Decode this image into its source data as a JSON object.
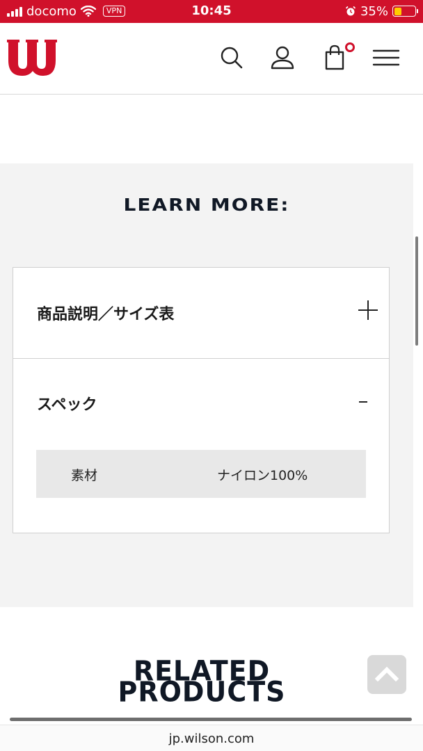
{
  "status_bar": {
    "carrier": "docomo",
    "vpn": "VPN",
    "time": "10:45",
    "battery": "35%",
    "battery_level": 0.35
  },
  "header": {
    "logo": "wilson-logo",
    "icons": [
      "search-icon",
      "user-icon",
      "cart-icon",
      "menu-icon"
    ],
    "cart_count": "0"
  },
  "learn_more": {
    "title": "LEARN MORE:",
    "sections": [
      {
        "label": "商品説明／サイズ表",
        "state": "collapsed"
      },
      {
        "label": "スペック",
        "state": "expanded"
      }
    ],
    "specs": [
      {
        "key": "素材",
        "value": "ナイロン100%"
      }
    ]
  },
  "related": {
    "line1": "RELATED",
    "line2": "PRODUCTS"
  },
  "browser": {
    "url": "jp.wilson.com"
  },
  "colors": {
    "brand_red": "#d0112b",
    "heading_navy": "#101825",
    "panel_gray": "#f3f3f3",
    "battery_yellow": "#ffcc00"
  }
}
